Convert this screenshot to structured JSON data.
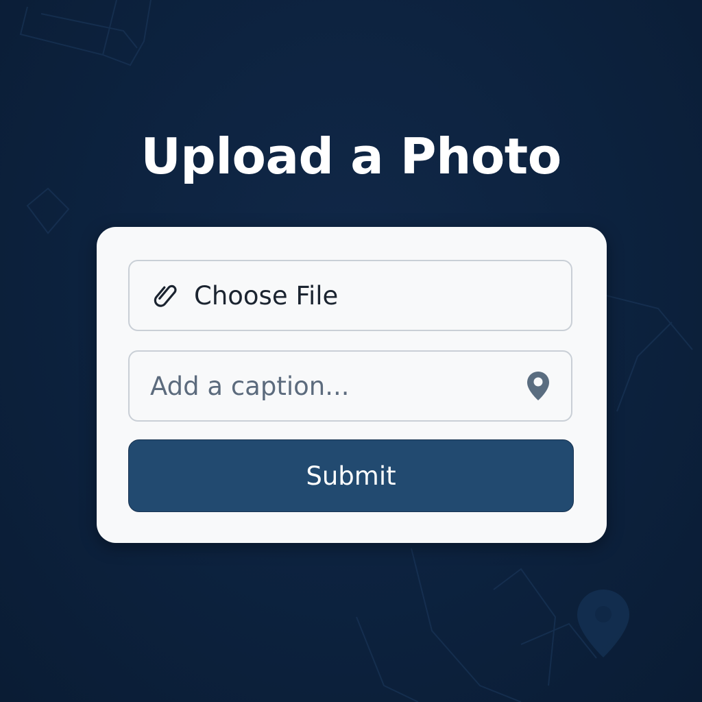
{
  "page": {
    "title": "Upload a Photo"
  },
  "form": {
    "file_button_label": "Choose File",
    "file_icon": "paperclip-icon",
    "caption_value": "",
    "caption_placeholder": "Add a caption...",
    "caption_icon": "location-pin-icon",
    "submit_label": "Submit"
  },
  "colors": {
    "background": "#0d2340",
    "card": "#f8f9fa",
    "field_border": "#c9cfd6",
    "submit_button": "#224a70",
    "placeholder_text": "#5c6b7d",
    "pin_icon": "#5a6d80"
  }
}
